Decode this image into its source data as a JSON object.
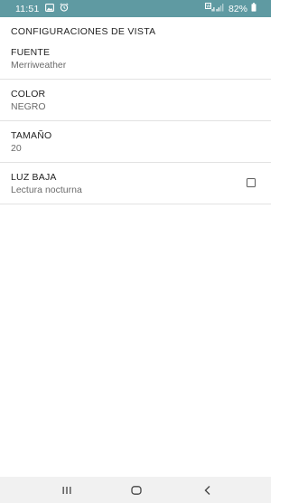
{
  "status_bar": {
    "time": "11:51",
    "battery_percent": "82%",
    "background_color": "#5f9aa2",
    "icons": [
      "gallery-icon",
      "alarm-icon",
      "wifi-icon",
      "signal-icon",
      "battery-icon"
    ]
  },
  "screen": {
    "section_title": "CONFIGURACIONES DE VISTA",
    "settings": [
      {
        "title": "FUENTE",
        "summary": "Merriweather"
      },
      {
        "title": "COLOR",
        "summary": "NEGRO"
      },
      {
        "title": "TAMAÑO",
        "summary": "20"
      },
      {
        "title": "LUZ BAJA",
        "summary": "Lectura nocturna",
        "checked": false
      }
    ]
  },
  "nav_bar": {
    "buttons": [
      "recents-icon",
      "home-icon",
      "back-icon"
    ]
  }
}
